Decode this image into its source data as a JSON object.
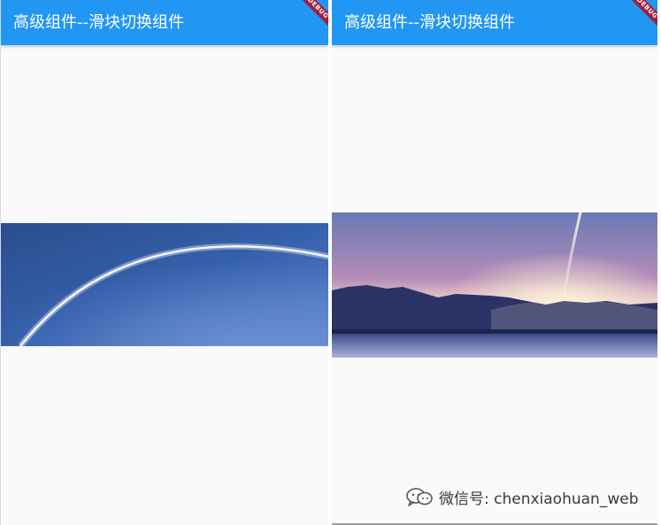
{
  "left_screen": {
    "appbar": {
      "title": "高级组件--滑块切换组件"
    },
    "debug_banner": {
      "label": "DEBUG"
    }
  },
  "right_screen": {
    "appbar": {
      "title": "高级组件--滑块切换组件"
    },
    "debug_banner": {
      "label": "DEBUG"
    }
  },
  "watermark": {
    "icon": "wechat-icon",
    "text": "微信号: chenxiaohuan_web"
  },
  "colors": {
    "appbar": "#2196f3",
    "background": "#fafafa",
    "debug_banner": "#a0203e"
  }
}
